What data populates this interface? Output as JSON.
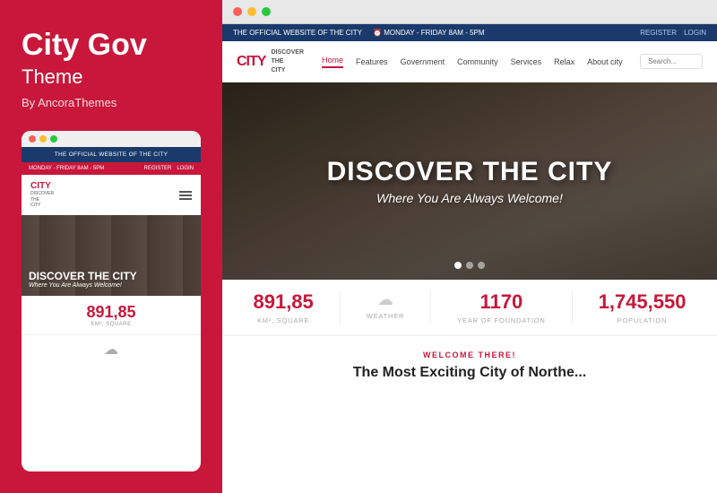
{
  "brand": {
    "title": "City Gov",
    "subtitle": "Theme",
    "author": "By AncoraThemes"
  },
  "mobile_preview": {
    "official_text": "THE OFFICIAL WEBSITE OF THE CITY",
    "hours": "MONDAY - FRIDAY 8AM - 5PM",
    "register": "REGISTER",
    "login": "LOGIN",
    "logo_mark": "CITY",
    "logo_sub": "DISCOVER\nTHE\nCITY",
    "hero_title": "DISCOVER THE CITY",
    "hero_sub": "Where You Are Always Welcome!",
    "stat_number": "891,85",
    "stat_label": "KM², SQUARE"
  },
  "desktop_preview": {
    "topbar": {
      "official": "THE OFFICIAL WEBSITE OF THE CITY",
      "hours": "MONDAY - FRIDAY 8AM - 5PM",
      "register": "REGISTER",
      "login": "LOGIN"
    },
    "nav": {
      "logo_mark": "CITY",
      "logo_sub": "DISCOVER THE CITY",
      "links": [
        "Home",
        "Features",
        "Government",
        "Community",
        "Services",
        "Relax",
        "About city"
      ],
      "search_placeholder": "Search..."
    },
    "hero": {
      "title": "DISCOVER THE CITY",
      "subtitle": "Where You Are Always Welcome!"
    },
    "stats": [
      {
        "value": "891,85",
        "label": "KM², SQUARE",
        "type": "number"
      },
      {
        "value": "☁",
        "label": "WEATHER",
        "type": "icon"
      },
      {
        "value": "1170",
        "label": "YEAR OF FOUNDATION",
        "type": "number"
      },
      {
        "value": "1,745,550",
        "label": "POPULATION",
        "type": "number"
      }
    ],
    "welcome": {
      "label": "WELCOME THERE!",
      "title": "The Most Exciting City of Northe..."
    }
  }
}
